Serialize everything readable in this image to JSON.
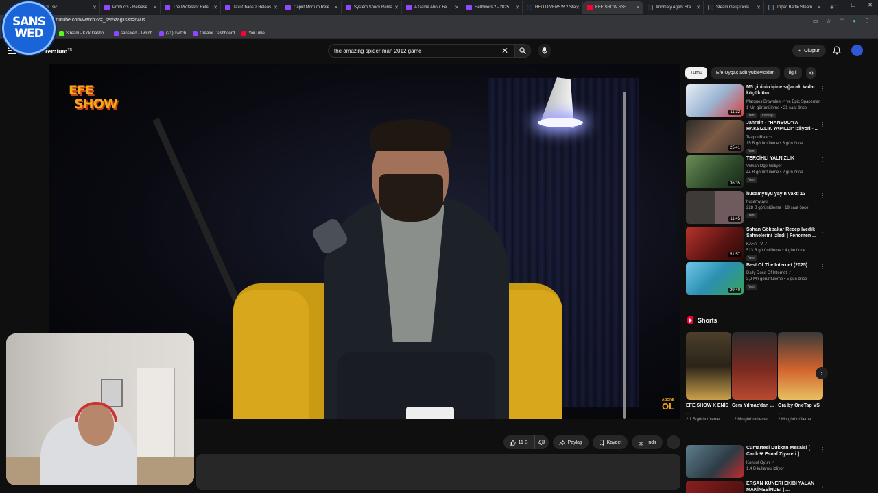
{
  "browser": {
    "tabs": [
      {
        "label": "sic",
        "color": "#555"
      },
      {
        "label": "Products - Release",
        "color": "#9146ff"
      },
      {
        "label": "The Professor Rele",
        "color": "#9146ff"
      },
      {
        "label": "Taxi Chaos 2 Releas",
        "color": "#9146ff"
      },
      {
        "label": "Caput Mortum Rele",
        "color": "#9146ff"
      },
      {
        "label": "System Shock Rema",
        "color": "#9146ff"
      },
      {
        "label": "A Game About Fe",
        "color": "#9146ff"
      },
      {
        "label": "Helldivers 2 - 2025",
        "color": "#9146ff"
      },
      {
        "label": "HELLDIVERS™ 2 Sta",
        "color": "#1b2838"
      },
      {
        "label": "EFE SHOW S3E",
        "color": "#ff0033",
        "active": true
      },
      {
        "label": "Anomaly Agent Sta",
        "color": "#1b2838"
      },
      {
        "label": "Steam Geliştiricisi",
        "color": "#1b2838"
      },
      {
        "label": "Topac Battle Steam",
        "color": "#1b2838"
      }
    ],
    "url": "youtube.com/watch?v=_ser5zagTs&t=640s",
    "bookmarks": [
      "Stream - Kick Dashb...",
      "sanswed - Twitch",
      "(21) Twitch",
      "Creator Dashboard",
      "YouTube"
    ]
  },
  "youtube": {
    "logo": "Premium",
    "logo_sup": "TR",
    "search_query": "the amazing spider man 2012 game",
    "create_label": "Oluştur"
  },
  "video": {
    "channel_watermark": [
      "EFE",
      "SHOW"
    ],
    "subscribe_watermark": [
      "ABONE",
      "OL"
    ],
    "actions": {
      "likes": "11 B",
      "share": "Paylaş",
      "save": "Kaydet",
      "download": "İndir"
    }
  },
  "overlay_logo": [
    "SANS",
    "WED"
  ],
  "chips": [
    "Tümü",
    "Efe Uygaç adlı yükleyiciden",
    "İlgili",
    "S"
  ],
  "recommendations": [
    {
      "title": "M5 çipinin içine sığacak kadar küçüldüm.",
      "channel": "Marques Brownlee ✓ ve Epic Spaceman",
      "stats": "1 Mn görüntüleme • 21 saat önce",
      "badges": [
        "Yeni",
        "Dublajlı"
      ],
      "duration": "11:32",
      "thumb": "#c7d6e8"
    },
    {
      "title": "Jahrein - \"HANSUO'YA HAKSIZLIK YAPILDI\" İzliyori - ...",
      "channel": "TeapodReacts",
      "stats": "15 B görüntüleme • 3 gün önce",
      "badges": [
        "Yeni"
      ],
      "duration": "25:41",
      "thumb": "#5c4a3b"
    },
    {
      "title": "TERCİHLİ YALNIZLIK",
      "channel": "Volkan Öge Geliyor",
      "stats": "44 B görüntüleme • 2 gün önce",
      "badges": [
        "Yeni"
      ],
      "duration": "36:35",
      "thumb": "#3c5f3a"
    },
    {
      "title": "husamyuyu yayın vakti 13",
      "channel": "husamyuyu",
      "stats": "228 B görüntüleme • 19 saat önce",
      "badges": [
        "Yeni"
      ],
      "duration": "11:45",
      "thumb": "#4f4550"
    },
    {
      "title": "Şahan Gökbakar Recep İvedik Sahnelerini İzledi | Fenomen ...",
      "channel": "KAFA TV ✓",
      "stats": "513 B görüntüleme • 4 gün önce",
      "badges": [
        "Yeni"
      ],
      "duration": "51:57",
      "thumb": "#8a2a28"
    },
    {
      "title": "Best Of The Internet (2025)",
      "channel": "Daily Dose Of Internet ✓",
      "stats": "3,2 Mn görüntüleme • 5 gün önce",
      "badges": [
        "Yeni"
      ],
      "duration": "29:40",
      "thumb": "#2f8fb3"
    }
  ],
  "shorts_title": "Shorts",
  "shorts": [
    {
      "title": "EFE SHOW X ENİS ...",
      "views": "2,1 B görüntüleme",
      "thumb": "#3a3226"
    },
    {
      "title": "Cem Yılmaz'dan ...",
      "views": "12 Mn görüntüleme",
      "thumb": "#6d2d22"
    },
    {
      "title": "Ora by OneTap VS ...",
      "views": "2 Mn görüntüleme",
      "thumb": "#b4442f"
    }
  ],
  "recommendations2": [
    {
      "title": "Cumartesi Dükkan Mesaisi [ Canlı ❤ Esnaf Ziyareti ]",
      "channel": "Konsol Oyun ✓",
      "stats": "1,4 B kullanıcı izliyor",
      "thumb": "#4b6a7c"
    },
    {
      "title": "ERŞAN KUNERİ EKİBİ YALAN MAKİNESİNDE! | ...",
      "channel": "",
      "stats": "",
      "thumb": "#7a2020"
    }
  ]
}
